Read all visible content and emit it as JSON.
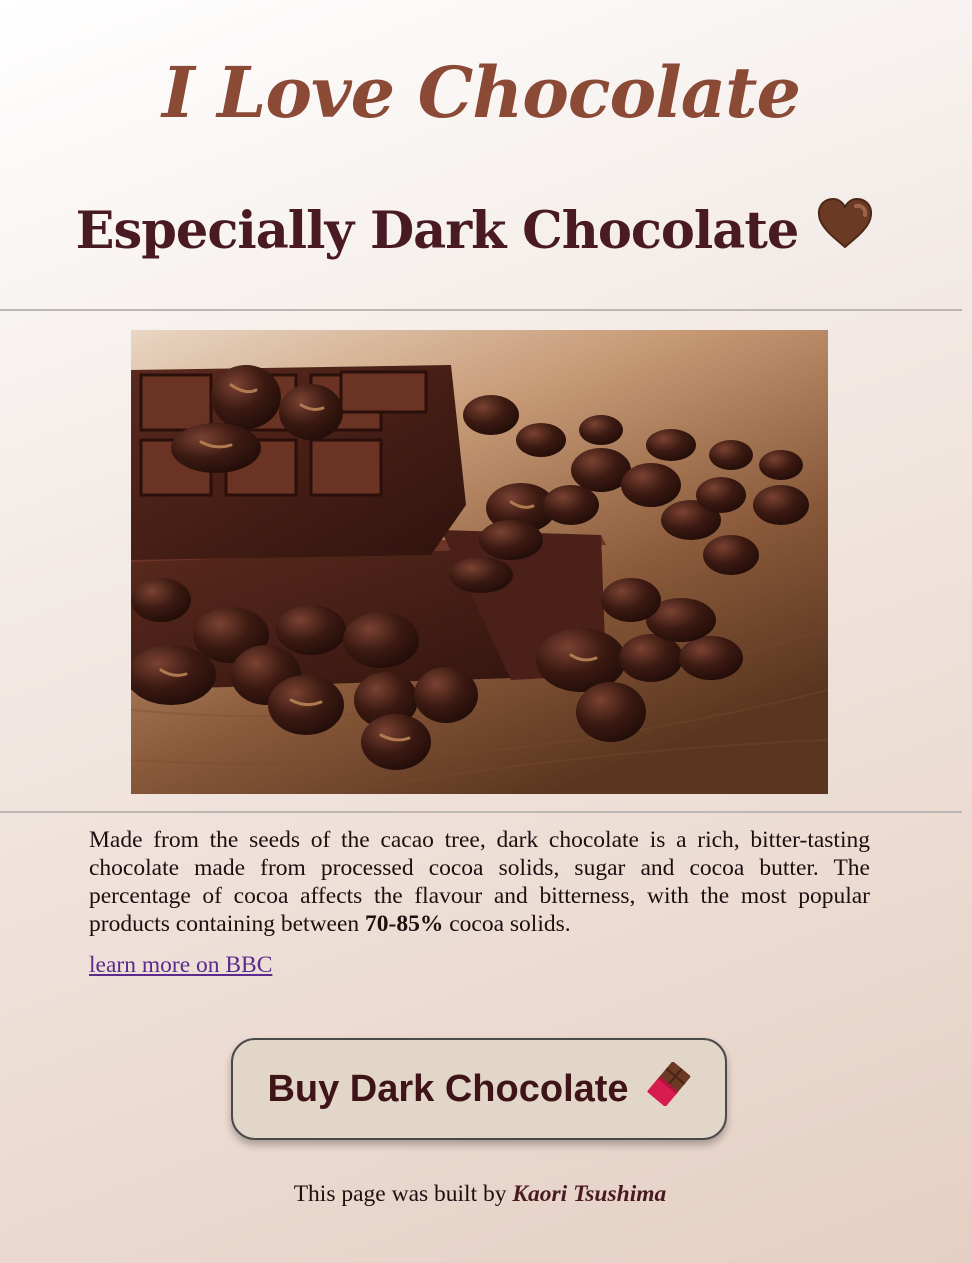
{
  "header": {
    "title": "I Love Chocolate",
    "subtitle": "Especially Dark Chocolate"
  },
  "icons": {
    "heart": "brown-heart-icon",
    "chocolate_bar": "chocolate-bar-icon"
  },
  "colors": {
    "title": "#8b4a36",
    "subtitle": "#4a1a22",
    "link": "#5c2a8c",
    "button_bg": "#e2d6c8"
  },
  "content": {
    "description_part1": "Made from the seeds of the cacao tree, dark chocolate is a rich, bitter-tasting chocolate made from processed cocoa solids, sugar and cocoa butter. The percentage of cocoa affects the flavour and bitterness, with the most popular products containing between ",
    "description_bold": "70-85%",
    "description_part2": " cocoa solids.",
    "link_label": "learn more on BBC"
  },
  "cta": {
    "label": "Buy Dark Chocolate"
  },
  "footer": {
    "prefix": "This page was built by ",
    "author": "Kaori Tsushima"
  }
}
